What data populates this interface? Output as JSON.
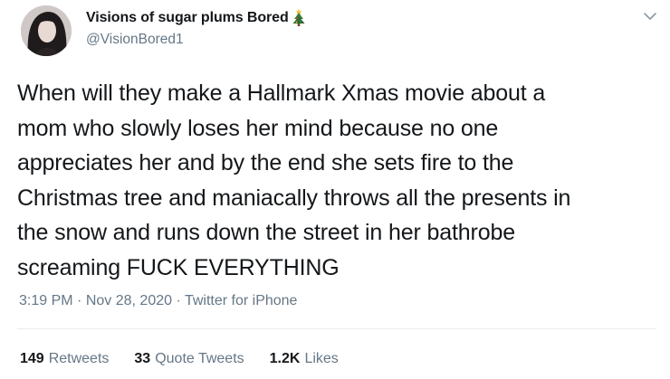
{
  "user": {
    "display_name": "Visions of sugar plums Bored",
    "handle": "@VisionBored1",
    "avatar_icon": "avatar-photo",
    "name_emoji_icon": "christmas-tree-icon"
  },
  "tweet": {
    "text": "When will they make a Hallmark Xmas movie about a\nmom who slowly loses her mind because no one\nappreciates her and by the end she sets fire to the\nChristmas tree and maniacally throws all the presents in\nthe snow and runs down the street in her bathrobe\nscreaming FUCK EVERYTHING"
  },
  "meta": {
    "time": "3:19 PM",
    "separator": "·",
    "date": "Nov 28, 2020",
    "source": "Twitter for iPhone"
  },
  "stats": {
    "retweets_count": "149",
    "retweets_label": "Retweets",
    "quotes_count": "33",
    "quotes_label": "Quote Tweets",
    "likes_count": "1.2K",
    "likes_label": "Likes"
  },
  "colors": {
    "text_primary": "#14171a",
    "text_secondary": "#657786",
    "divider": "#e6ecf0"
  },
  "menu_icon": "chevron-down-icon"
}
